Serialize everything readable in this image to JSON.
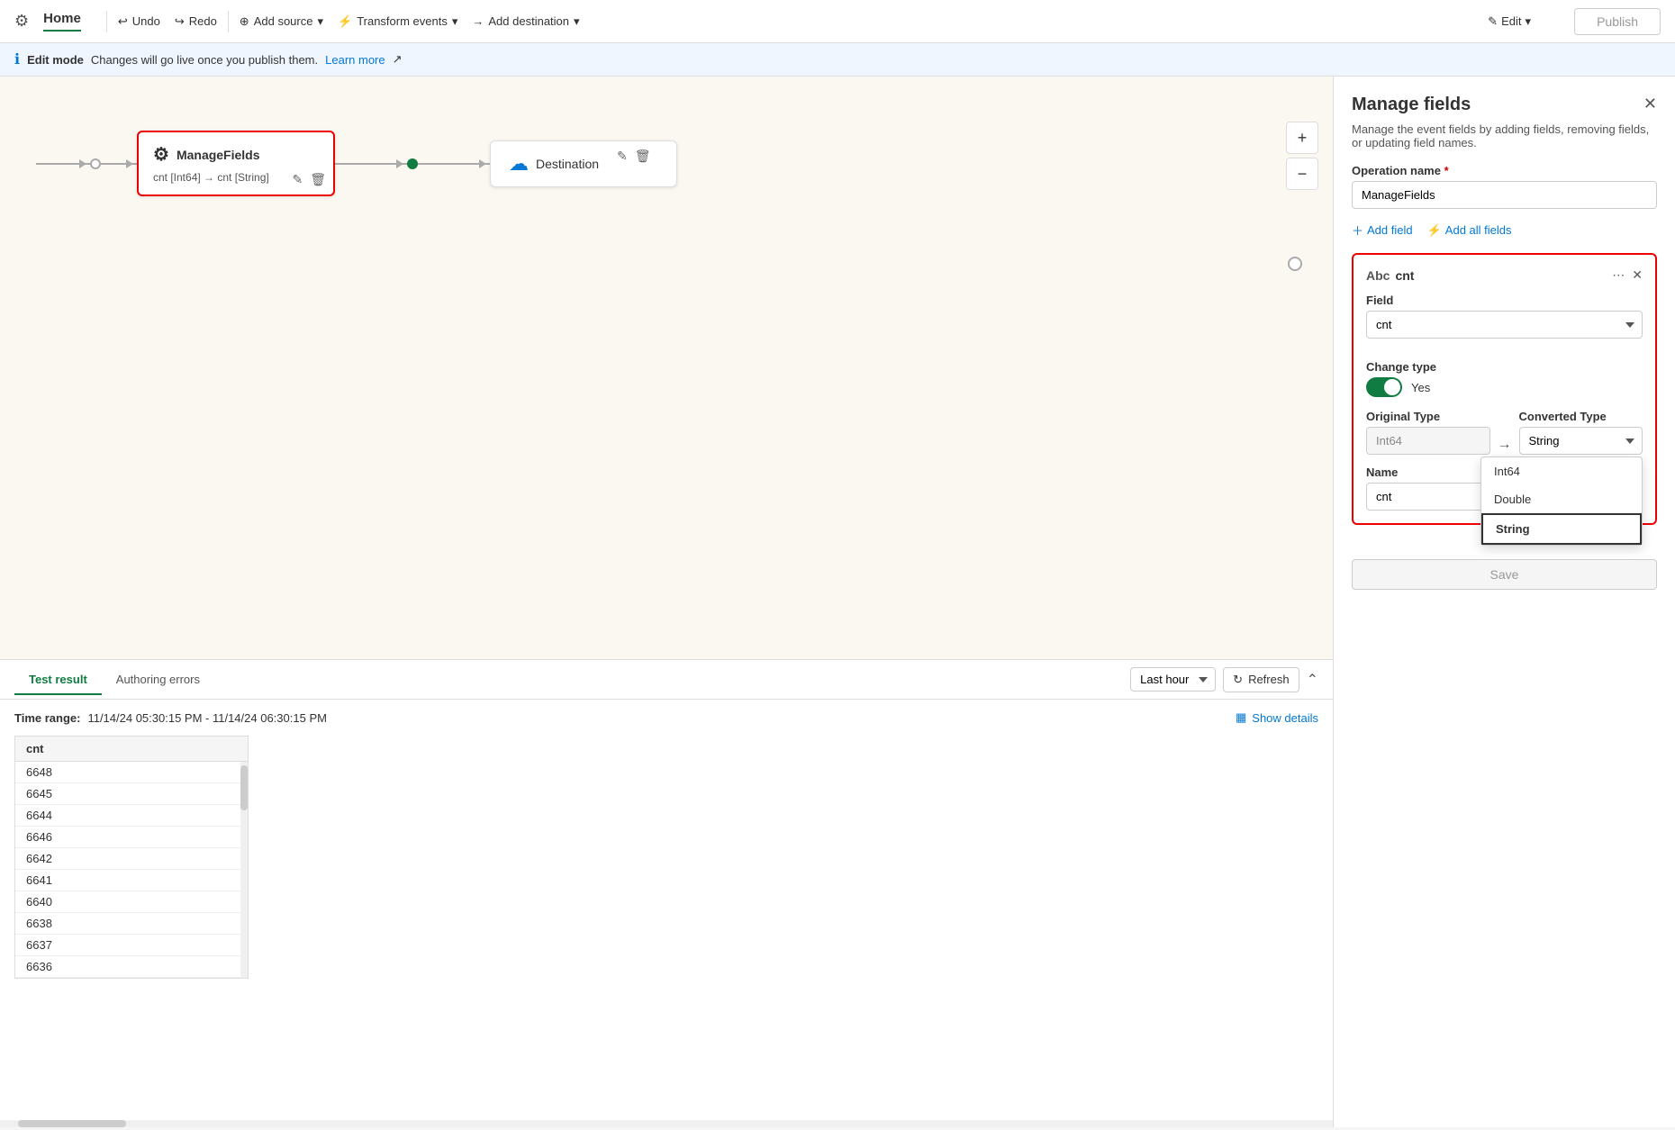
{
  "nav": {
    "home_label": "Home",
    "undo_label": "Undo",
    "redo_label": "Redo",
    "add_source_label": "Add source",
    "transform_events_label": "Transform events",
    "add_destination_label": "Add destination",
    "publish_label": "Publish",
    "edit_label": "Edit"
  },
  "info_bar": {
    "mode_label": "Edit mode",
    "message": "Changes will go live once you publish them.",
    "learn_more": "Learn more"
  },
  "canvas": {
    "node_name": "ManageFields",
    "node_desc": "cnt [Int64] → cnt [String]",
    "destination_label": "Destination"
  },
  "bottom_panel": {
    "tab_test": "Test result",
    "tab_errors": "Authoring errors",
    "time_option": "Last hour",
    "refresh_label": "Refresh",
    "time_range_label": "Time range:",
    "time_range_value": "11/14/24 05:30:15 PM - 11/14/24 06:30:15 PM",
    "show_details_label": "Show details",
    "table_header": "cnt",
    "table_rows": [
      "6648",
      "6645",
      "6644",
      "6646",
      "6642",
      "6641",
      "6640",
      "6638",
      "6637",
      "6636"
    ]
  },
  "manage_fields": {
    "panel_title": "Manage fields",
    "panel_desc": "Manage the event fields by adding fields, removing fields, or updating field names.",
    "operation_name_label": "Operation name",
    "operation_name_required": "*",
    "operation_name_value": "ManageFields",
    "add_field_label": "Add field",
    "add_all_fields_label": "Add all fields",
    "field_card": {
      "title": "cnt",
      "icon": "Abc",
      "field_label": "Field",
      "field_value": "cnt",
      "field_icon": "123",
      "change_type_label": "Change type",
      "toggle_value": "Yes",
      "original_type_label": "Original Type",
      "original_type_value": "Int64",
      "arrow": "→",
      "converted_type_label": "Converted Type",
      "converted_type_value": "String",
      "name_label": "Name",
      "name_value": "cnt",
      "dropdown_options": [
        "Int64",
        "Double",
        "String"
      ]
    },
    "save_label": "Save"
  }
}
